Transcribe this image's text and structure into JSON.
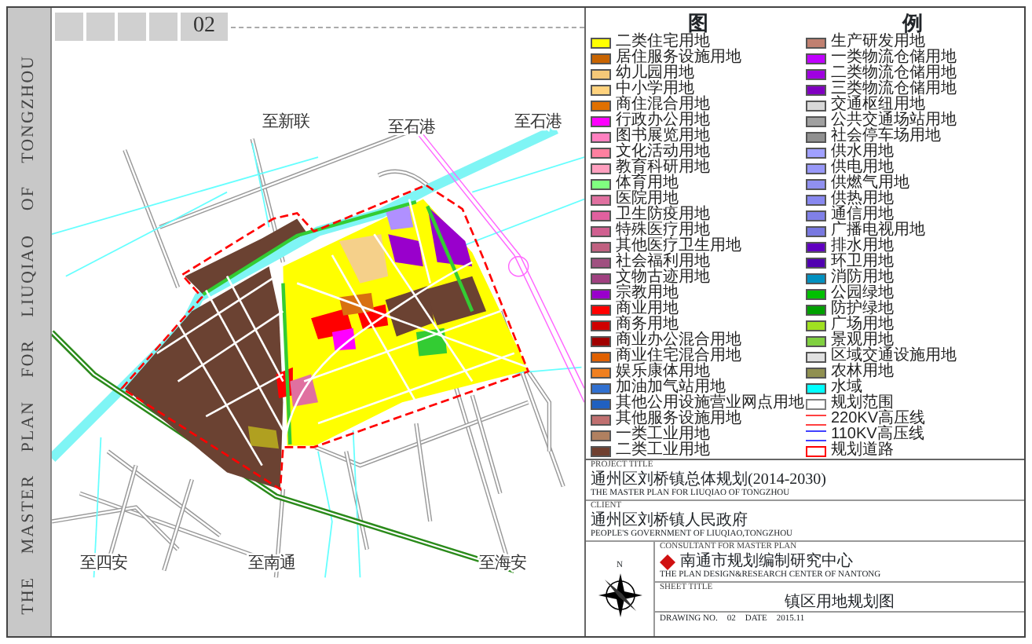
{
  "sheet": {
    "side_title": [
      "THE",
      "MASTER",
      "PLAN",
      "FOR",
      "LIUQIAO",
      "OF",
      "TONGZHOU"
    ],
    "sheet_number": "02"
  },
  "map": {
    "road_labels": [
      "至新联",
      "至石港",
      "至石港",
      "至四安",
      "至南通",
      "至海安"
    ]
  },
  "legend": {
    "title": [
      "图",
      "例"
    ],
    "items": [
      {
        "label": "二类住宅用地",
        "color": "#ffff00",
        "kind": "fill"
      },
      {
        "label": "居住服务设施用地",
        "color": "#c86400",
        "kind": "fill"
      },
      {
        "label": "幼儿园用地",
        "color": "#f5c878",
        "kind": "fill"
      },
      {
        "label": "中小学用地",
        "color": "#ffd27d",
        "kind": "fill"
      },
      {
        "label": "商住混合用地",
        "color": "#e07000",
        "kind": "fill"
      },
      {
        "label": "行政办公用地",
        "color": "#ff00ff",
        "kind": "fill"
      },
      {
        "label": "图书展览用地",
        "color": "#ff80c0",
        "kind": "fill"
      },
      {
        "label": "文化活动用地",
        "color": "#ff80a0",
        "kind": "fill"
      },
      {
        "label": "教育科研用地",
        "color": "#ff9fbf",
        "kind": "fill"
      },
      {
        "label": "体育用地",
        "color": "#80ff80",
        "kind": "fill"
      },
      {
        "label": "医院用地",
        "color": "#e070a0",
        "kind": "fill"
      },
      {
        "label": "卫生防疫用地",
        "color": "#e0609f",
        "kind": "fill"
      },
      {
        "label": "特殊医疗用地",
        "color": "#d06090",
        "kind": "fill"
      },
      {
        "label": "其他医疗卫生用地",
        "color": "#c06080",
        "kind": "fill"
      },
      {
        "label": "社会福利用地",
        "color": "#a05080",
        "kind": "fill"
      },
      {
        "label": "文物古迹用地",
        "color": "#a04080",
        "kind": "fill"
      },
      {
        "label": "宗教用地",
        "color": "#9900cc",
        "kind": "fill"
      },
      {
        "label": "商业用地",
        "color": "#ff0000",
        "kind": "fill"
      },
      {
        "label": "商务用地",
        "color": "#d00000",
        "kind": "fill"
      },
      {
        "label": "商业办公混合用地",
        "color": "#a00000",
        "kind": "fill"
      },
      {
        "label": "商业住宅混合用地",
        "color": "#e06000",
        "kind": "fill"
      },
      {
        "label": "娱乐康体用地",
        "color": "#f08020",
        "kind": "fill"
      },
      {
        "label": "加油加气站用地",
        "color": "#3070d0",
        "kind": "fill"
      },
      {
        "label": "其他公用设施营业网点用地",
        "color": "#2060c0",
        "kind": "fill"
      },
      {
        "label": "其他服务设施用地",
        "color": "#c07070",
        "kind": "fill"
      },
      {
        "label": "一类工业用地",
        "color": "#b08060",
        "kind": "fill"
      },
      {
        "label": "二类工业用地",
        "color": "#704030",
        "kind": "fill"
      },
      {
        "label": "生产研发用地",
        "color": "#c08070",
        "kind": "fill"
      },
      {
        "label": "一类物流仓储用地",
        "color": "#c000ff",
        "kind": "fill"
      },
      {
        "label": "二类物流仓储用地",
        "color": "#a000e0",
        "kind": "fill"
      },
      {
        "label": "三类物流仓储用地",
        "color": "#8000c0",
        "kind": "fill"
      },
      {
        "label": "交通枢纽用地",
        "color": "#d8d8d8",
        "kind": "fill"
      },
      {
        "label": "公共交通场站用地",
        "color": "#a0a0a0",
        "kind": "fill"
      },
      {
        "label": "社会停车场用地",
        "color": "#909090",
        "kind": "fill"
      },
      {
        "label": "供水用地",
        "color": "#a0a0ff",
        "kind": "fill"
      },
      {
        "label": "供电用地",
        "color": "#9898f8",
        "kind": "fill"
      },
      {
        "label": "供燃气用地",
        "color": "#9090f0",
        "kind": "fill"
      },
      {
        "label": "供热用地",
        "color": "#8888f0",
        "kind": "fill"
      },
      {
        "label": "通信用地",
        "color": "#8080e8",
        "kind": "fill"
      },
      {
        "label": "广播电视用地",
        "color": "#7878e0",
        "kind": "fill"
      },
      {
        "label": "排水用地",
        "color": "#6000c0",
        "kind": "fill"
      },
      {
        "label": "环卫用地",
        "color": "#5000b0",
        "kind": "fill"
      },
      {
        "label": "消防用地",
        "color": "#0090c0",
        "kind": "fill"
      },
      {
        "label": "公园绿地",
        "color": "#00c000",
        "kind": "fill"
      },
      {
        "label": "防护绿地",
        "color": "#00a000",
        "kind": "fill"
      },
      {
        "label": "广场用地",
        "color": "#a0e020",
        "kind": "fill"
      },
      {
        "label": "景观用地",
        "color": "#80d040",
        "kind": "fill"
      },
      {
        "label": "区域交通设施用地",
        "color": "#e0e0e0",
        "kind": "fill"
      },
      {
        "label": "农林用地",
        "color": "#909050",
        "kind": "fill"
      },
      {
        "label": "水域",
        "color": "#00ffff",
        "kind": "fill"
      },
      {
        "label": "规划范围",
        "color": "#808080",
        "kind": "outline"
      },
      {
        "label": "220KV高压线",
        "color": "#ff4040",
        "kind": "double-line"
      },
      {
        "label": "110KV高压线",
        "color": "#4040ff",
        "kind": "double-line"
      },
      {
        "label": "规划道路",
        "color": "#ff0000",
        "kind": "outline"
      }
    ]
  },
  "title_block": {
    "project_title_label": "PROJECT TITLE",
    "project_title": "通州区刘桥镇总体规划(2014-2030)",
    "project_title_en": "THE MASTER PLAN FOR LIUQIAO OF TONGZHOU",
    "client_label": "CLIENT",
    "client": "通州区刘桥镇人民政府",
    "client_en": "PEOPLE'S GOVERNMENT OF LIUQIAO,TONGZHOU",
    "compass_label": "N",
    "consultant_label": "CONSULTANT FOR MASTER PLAN",
    "consultant": "南通市规划编制研究中心",
    "consultant_en": "THE PLAN DESIGN&RESEARCH CENTER OF NANTONG",
    "sheet_title_label": "SHEET TITLE",
    "sheet_title": "镇区用地规划图",
    "drawing_no_label": "DRAWING NO.",
    "drawing_no": "02",
    "date_label": "DATE",
    "date": "2015.11"
  }
}
